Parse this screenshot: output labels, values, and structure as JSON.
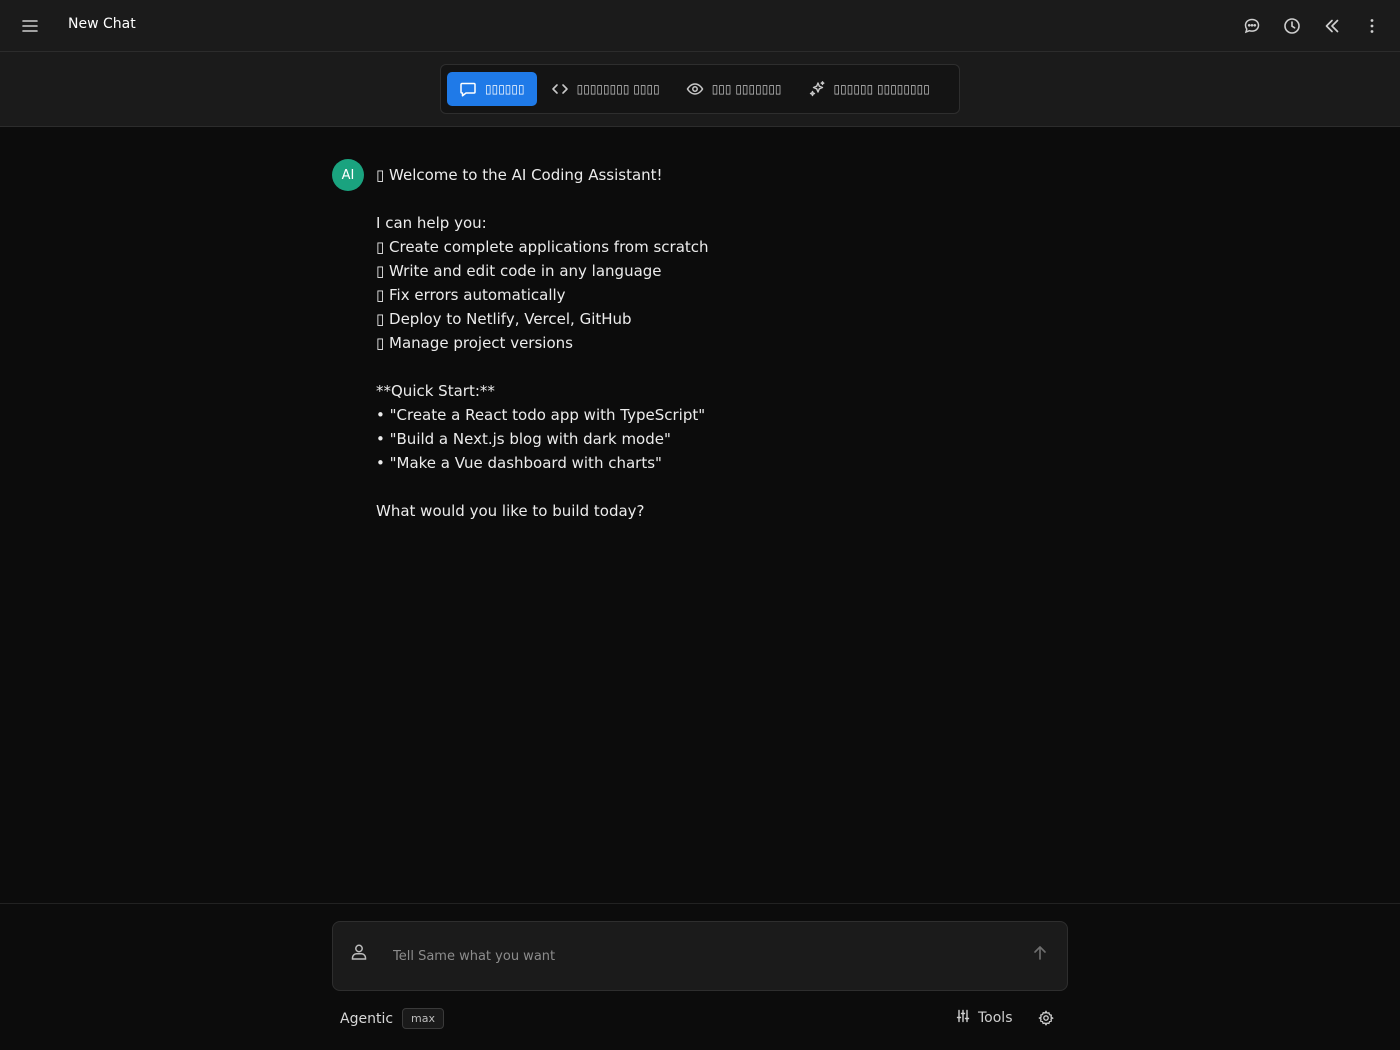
{
  "header": {
    "title": "New Chat",
    "icons": [
      "menu-icon",
      "chat-bubble-icon",
      "history-clock-icon",
      "collapse-chevrons-icon",
      "more-vertical-icon"
    ]
  },
  "tabs": [
    {
      "label": "▯▯▯▯▯▯",
      "icon": "chat-bubble-icon",
      "active": true
    },
    {
      "label": "▯▯▯▯▯▯▯▯ ▯▯▯▯",
      "icon": "code-icon",
      "active": false
    },
    {
      "label": "▯▯▯ ▯▯▯▯▯▯▯",
      "icon": "eye-icon",
      "active": false
    },
    {
      "label": "▯▯▯▯▯▯ ▯▯▯▯▯▯▯▯",
      "icon": "sparkles-icon",
      "active": false
    }
  ],
  "message": {
    "avatar": "AI",
    "lines": [
      "▯ Welcome to the AI Coding Assistant!",
      "",
      "I can help you:",
      "▯ Create complete applications from scratch",
      "▯ Write and edit code in any language",
      "▯ Fix errors automatically",
      "▯ Deploy to Netlify, Vercel, GitHub",
      "▯ Manage project versions",
      "",
      "**Quick Start:**",
      "• \"Create a React todo app with TypeScript\"",
      "• \"Build a Next.js blog with dark mode\"",
      "• \"Make a Vue dashboard with charts\"",
      "",
      "What would you like to build today?"
    ]
  },
  "composer": {
    "placeholder": "Tell Same what you want",
    "value": ""
  },
  "footer": {
    "mode_label": "Agentic",
    "mode_badge": "max",
    "tools_label": "Tools"
  },
  "colors": {
    "accent": "#1f7ae8",
    "avatar": "#1aa37f",
    "background": "#0c0c0c",
    "surface": "#1b1b1b"
  }
}
